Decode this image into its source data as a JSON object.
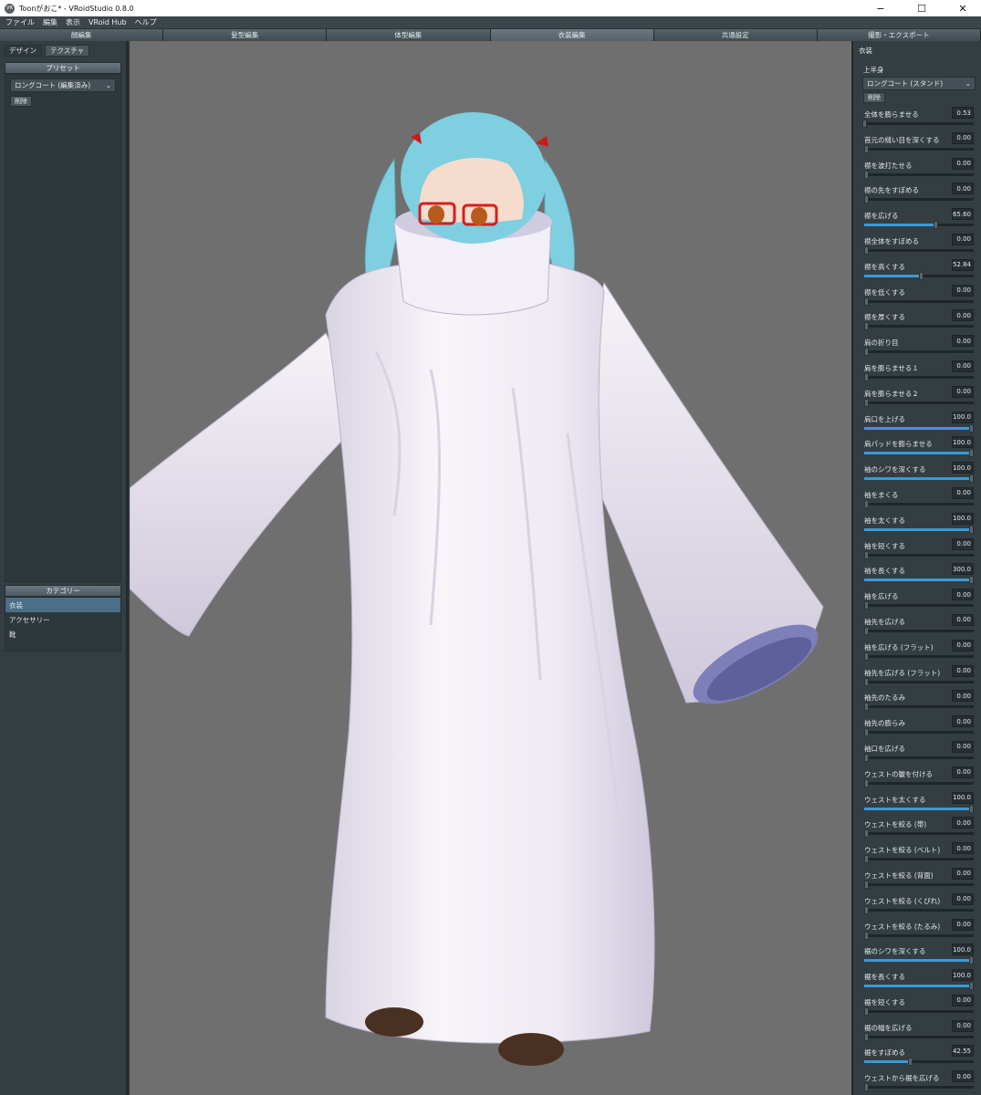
{
  "titlebar": {
    "logo": "VR",
    "title": "Toonがおこ* - VRoidStudio 0.8.0",
    "minimize": "−",
    "maximize": "☐",
    "close": "✕"
  },
  "menu": [
    "ファイル",
    "編集",
    "表示",
    "VRoid Hub",
    "ヘルプ"
  ],
  "tabs": [
    {
      "label": "顔編集",
      "active": false
    },
    {
      "label": "髪型編集",
      "active": false
    },
    {
      "label": "体型編集",
      "active": false
    },
    {
      "label": "衣装編集",
      "active": true
    },
    {
      "label": "共通設定",
      "active": false
    },
    {
      "label": "撮影・エクスポート",
      "active": false
    }
  ],
  "left": {
    "subtabs": [
      {
        "label": "デザイン",
        "active": true
      },
      {
        "label": "テクスチャ",
        "active": false
      }
    ],
    "preset": {
      "heading": "プリセット",
      "selected": "ロングコート (編集済み)",
      "delete": "削除"
    },
    "category": {
      "heading": "カテゴリー",
      "items": [
        {
          "label": "衣装",
          "active": true
        },
        {
          "label": "アクセサリー",
          "active": false
        },
        {
          "label": "靴",
          "active": false
        }
      ]
    }
  },
  "right": {
    "heading": "衣装",
    "section": "上半身",
    "selected": "ロングコート (スタンド)",
    "delete": "削除",
    "sliders": [
      {
        "label": "全体を膨らませる",
        "value": "0.53",
        "level": 0.01
      },
      {
        "label": "首元の縫い目を深くする",
        "value": "0.00",
        "level": 0
      },
      {
        "label": "襟を波打たせる",
        "value": "0.00",
        "level": 0
      },
      {
        "label": "襟の先をすぼめる",
        "value": "0.00",
        "level": 0
      },
      {
        "label": "襟を広げる",
        "value": "65.60",
        "level": 0.656
      },
      {
        "label": "襟全体をすぼめる",
        "value": "0.00",
        "level": 0
      },
      {
        "label": "襟を高くする",
        "value": "52.84",
        "level": 0.528
      },
      {
        "label": "襟を低くする",
        "value": "0.00",
        "level": 0
      },
      {
        "label": "襟を厚くする",
        "value": "0.00",
        "level": 0
      },
      {
        "label": "肩の折り目",
        "value": "0.00",
        "level": 0
      },
      {
        "label": "肩を膨らませる１",
        "value": "0.00",
        "level": 0
      },
      {
        "label": "肩を膨らませる２",
        "value": "0.00",
        "level": 0
      },
      {
        "label": "肩口を上げる",
        "value": "100.0",
        "level": 1
      },
      {
        "label": "肩パッドを膨らませる",
        "value": "100.0",
        "level": 1
      },
      {
        "label": "袖のシワを深くする",
        "value": "100.0",
        "level": 1
      },
      {
        "label": "袖をまくる",
        "value": "0.00",
        "level": 0
      },
      {
        "label": "袖を太くする",
        "value": "100.0",
        "level": 1
      },
      {
        "label": "袖を短くする",
        "value": "0.00",
        "level": 0
      },
      {
        "label": "袖を長くする",
        "value": "300.0",
        "level": 1
      },
      {
        "label": "袖を広げる",
        "value": "0.00",
        "level": 0
      },
      {
        "label": "袖先を広げる",
        "value": "0.00",
        "level": 0
      },
      {
        "label": "袖を広げる (フラット)",
        "value": "0.00",
        "level": 0
      },
      {
        "label": "袖先を広げる (フラット)",
        "value": "0.00",
        "level": 0
      },
      {
        "label": "袖先のたるみ",
        "value": "0.00",
        "level": 0
      },
      {
        "label": "袖先の膨らみ",
        "value": "0.00",
        "level": 0
      },
      {
        "label": "袖口を広げる",
        "value": "0.00",
        "level": 0
      },
      {
        "label": "ウェストの皺を付ける",
        "value": "0.00",
        "level": 0
      },
      {
        "label": "ウェストを太くする",
        "value": "100.0",
        "level": 1
      },
      {
        "label": "ウェストを絞る (帯)",
        "value": "0.00",
        "level": 0
      },
      {
        "label": "ウェストを絞る (ベルト)",
        "value": "0.00",
        "level": 0
      },
      {
        "label": "ウェストを絞る (背面)",
        "value": "0.00",
        "level": 0
      },
      {
        "label": "ウェストを絞る (くびれ)",
        "value": "0.00",
        "level": 0
      },
      {
        "label": "ウェストを絞る (たるみ)",
        "value": "0.00",
        "level": 0
      },
      {
        "label": "裾のシワを深くする",
        "value": "100.0",
        "level": 1
      },
      {
        "label": "裾を長くする",
        "value": "100.0",
        "level": 1
      },
      {
        "label": "裾を短くする",
        "value": "0.00",
        "level": 0
      },
      {
        "label": "裾の幅を広げる",
        "value": "0.00",
        "level": 0
      },
      {
        "label": "裾をすぼめる",
        "value": "42.55",
        "level": 0.425
      },
      {
        "label": "ウェストから裾を広げる",
        "value": "0.00",
        "level": 0
      }
    ]
  },
  "colors": {
    "accent": "#3a9ad8",
    "viewport_bg": "#6f6f6f",
    "hair": "#7ecfe0",
    "coat": "#f4f0f5",
    "coat_shadow": "#c9c3d6",
    "cuff_inner": "#7d7fb8",
    "shoes": "#4a3020",
    "ribbon": "#cc1a1a"
  }
}
